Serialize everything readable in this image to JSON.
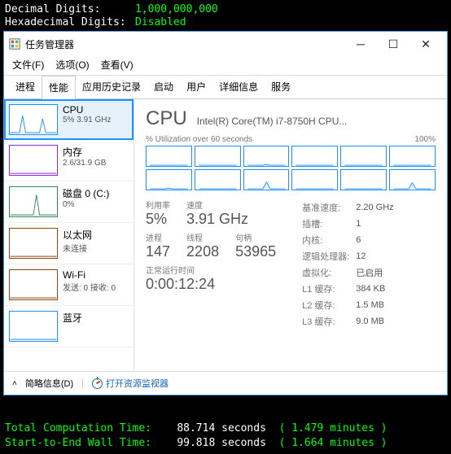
{
  "console_top": {
    "rows": [
      {
        "label": "Decimal Digits:",
        "value": "1,000,000,000"
      },
      {
        "label": "Hexadecimal Digits:",
        "value": "Disabled"
      }
    ]
  },
  "window": {
    "title": "任务管理器",
    "menu": [
      "文件(F)",
      "选项(O)",
      "查看(V)"
    ],
    "tabs": [
      "进程",
      "性能",
      "应用历史记录",
      "启动",
      "用户",
      "详细信息",
      "服务"
    ],
    "active_tab": 1
  },
  "sidebar": [
    {
      "name": "CPU",
      "sub": "5% 3.91 GHz",
      "color": "#1e90ff",
      "selected": true,
      "shape": "spike2"
    },
    {
      "name": "内存",
      "sub": "2.6/31.9 GB",
      "color": "#8a2be2",
      "selected": false,
      "shape": "flat"
    },
    {
      "name": "磁盘 0 (C:)",
      "sub": "0%",
      "color": "#2e8b57",
      "selected": false,
      "shape": "spike1"
    },
    {
      "name": "以太网",
      "sub": "未连接",
      "color": "#8b4513",
      "selected": false,
      "shape": "flat"
    },
    {
      "name": "Wi-Fi",
      "sub": "发送: 0 接收: 0",
      "color": "#8b4513",
      "selected": false,
      "shape": "flat"
    },
    {
      "name": "蓝牙",
      "sub": "",
      "color": "#1e90ff",
      "selected": false,
      "shape": "flat"
    }
  ],
  "main": {
    "title": "CPU",
    "model": "Intel(R) Core(TM) i7-8750H CPU...",
    "util_label": "% Utilization over 60 seconds",
    "util_max": "100%",
    "stats_left": {
      "row1": [
        {
          "lab": "利用率",
          "val": "5%"
        },
        {
          "lab": "速度",
          "val": "3.91 GHz"
        }
      ],
      "row2": [
        {
          "lab": "进程",
          "val": "147"
        },
        {
          "lab": "线程",
          "val": "2208"
        },
        {
          "lab": "句柄",
          "val": "53965"
        }
      ],
      "uptime": {
        "lab": "正常运行时间",
        "val": "0:00:12:24"
      }
    },
    "stats_right": [
      {
        "k": "基准速度:",
        "v": "2.20 GHz"
      },
      {
        "k": "插槽:",
        "v": "1"
      },
      {
        "k": "内核:",
        "v": "6"
      },
      {
        "k": "逻辑处理器:",
        "v": "12"
      },
      {
        "k": "虚拟化:",
        "v": "已启用"
      },
      {
        "k": "L1 缓存:",
        "v": "384 KB"
      },
      {
        "k": "L2 缓存:",
        "v": "1.5 MB"
      },
      {
        "k": "L3 缓存:",
        "v": "9.0 MB"
      }
    ]
  },
  "footer": {
    "brief": "简略信息(D)",
    "resmon": "打开资源监视器"
  },
  "console_bottom": {
    "rows": [
      {
        "label": "Total Computation Time:",
        "sec": "88.714 seconds",
        "min": "( 1.479 minutes )"
      },
      {
        "label": "Start-to-End Wall Time:",
        "sec": "99.818 seconds",
        "min": "( 1.664 minutes )"
      }
    ]
  },
  "chart_data": {
    "type": "line",
    "title": "% Utilization over 60 seconds",
    "ylim": [
      0,
      100
    ],
    "series_count": 12,
    "approx_values_percent": [
      5,
      4,
      6,
      3,
      5,
      4,
      8,
      3,
      40,
      4,
      5,
      35
    ]
  }
}
